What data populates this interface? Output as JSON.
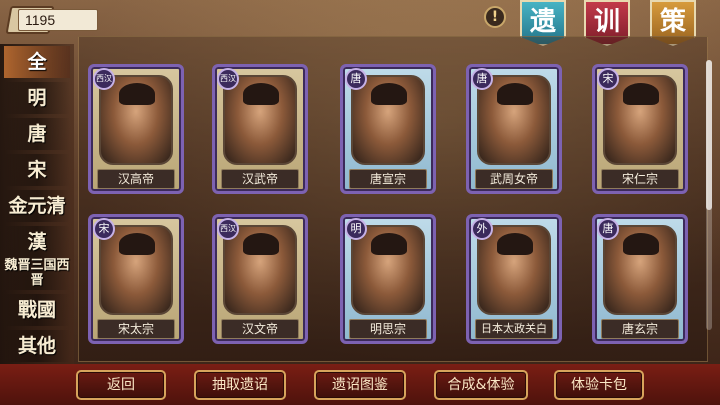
{
  "currency": {
    "value": "1195"
  },
  "top_tabs": [
    "遗",
    "训",
    "策"
  ],
  "alert_icon": "!",
  "sidebar": {
    "items": [
      {
        "label": "全",
        "active": true
      },
      {
        "label": "明"
      },
      {
        "label": "唐"
      },
      {
        "label": "宋"
      },
      {
        "label": "金元清"
      },
      {
        "label": "漢"
      },
      {
        "label": "魏晋三国西晋"
      },
      {
        "label": "戰國"
      },
      {
        "label": "其他"
      }
    ]
  },
  "cards": [
    {
      "badge": "西汉",
      "name": "汉高帝"
    },
    {
      "badge": "西汉",
      "name": "汉武帝"
    },
    {
      "badge": "唐",
      "name": "唐宣宗"
    },
    {
      "badge": "唐",
      "name": "武周女帝"
    },
    {
      "badge": "宋",
      "name": "宋仁宗"
    },
    {
      "badge": "宋",
      "name": "宋太宗"
    },
    {
      "badge": "西汉",
      "name": "汉文帝"
    },
    {
      "badge": "明",
      "name": "明思宗"
    },
    {
      "badge": "外",
      "name": "日本太政关白"
    },
    {
      "badge": "唐",
      "name": "唐玄宗"
    }
  ],
  "buttons": {
    "back": "返回",
    "draw": "抽取遗诏",
    "codex": "遗诏图鉴",
    "compose": "合成&体验",
    "trial_pack": "体验卡包"
  }
}
